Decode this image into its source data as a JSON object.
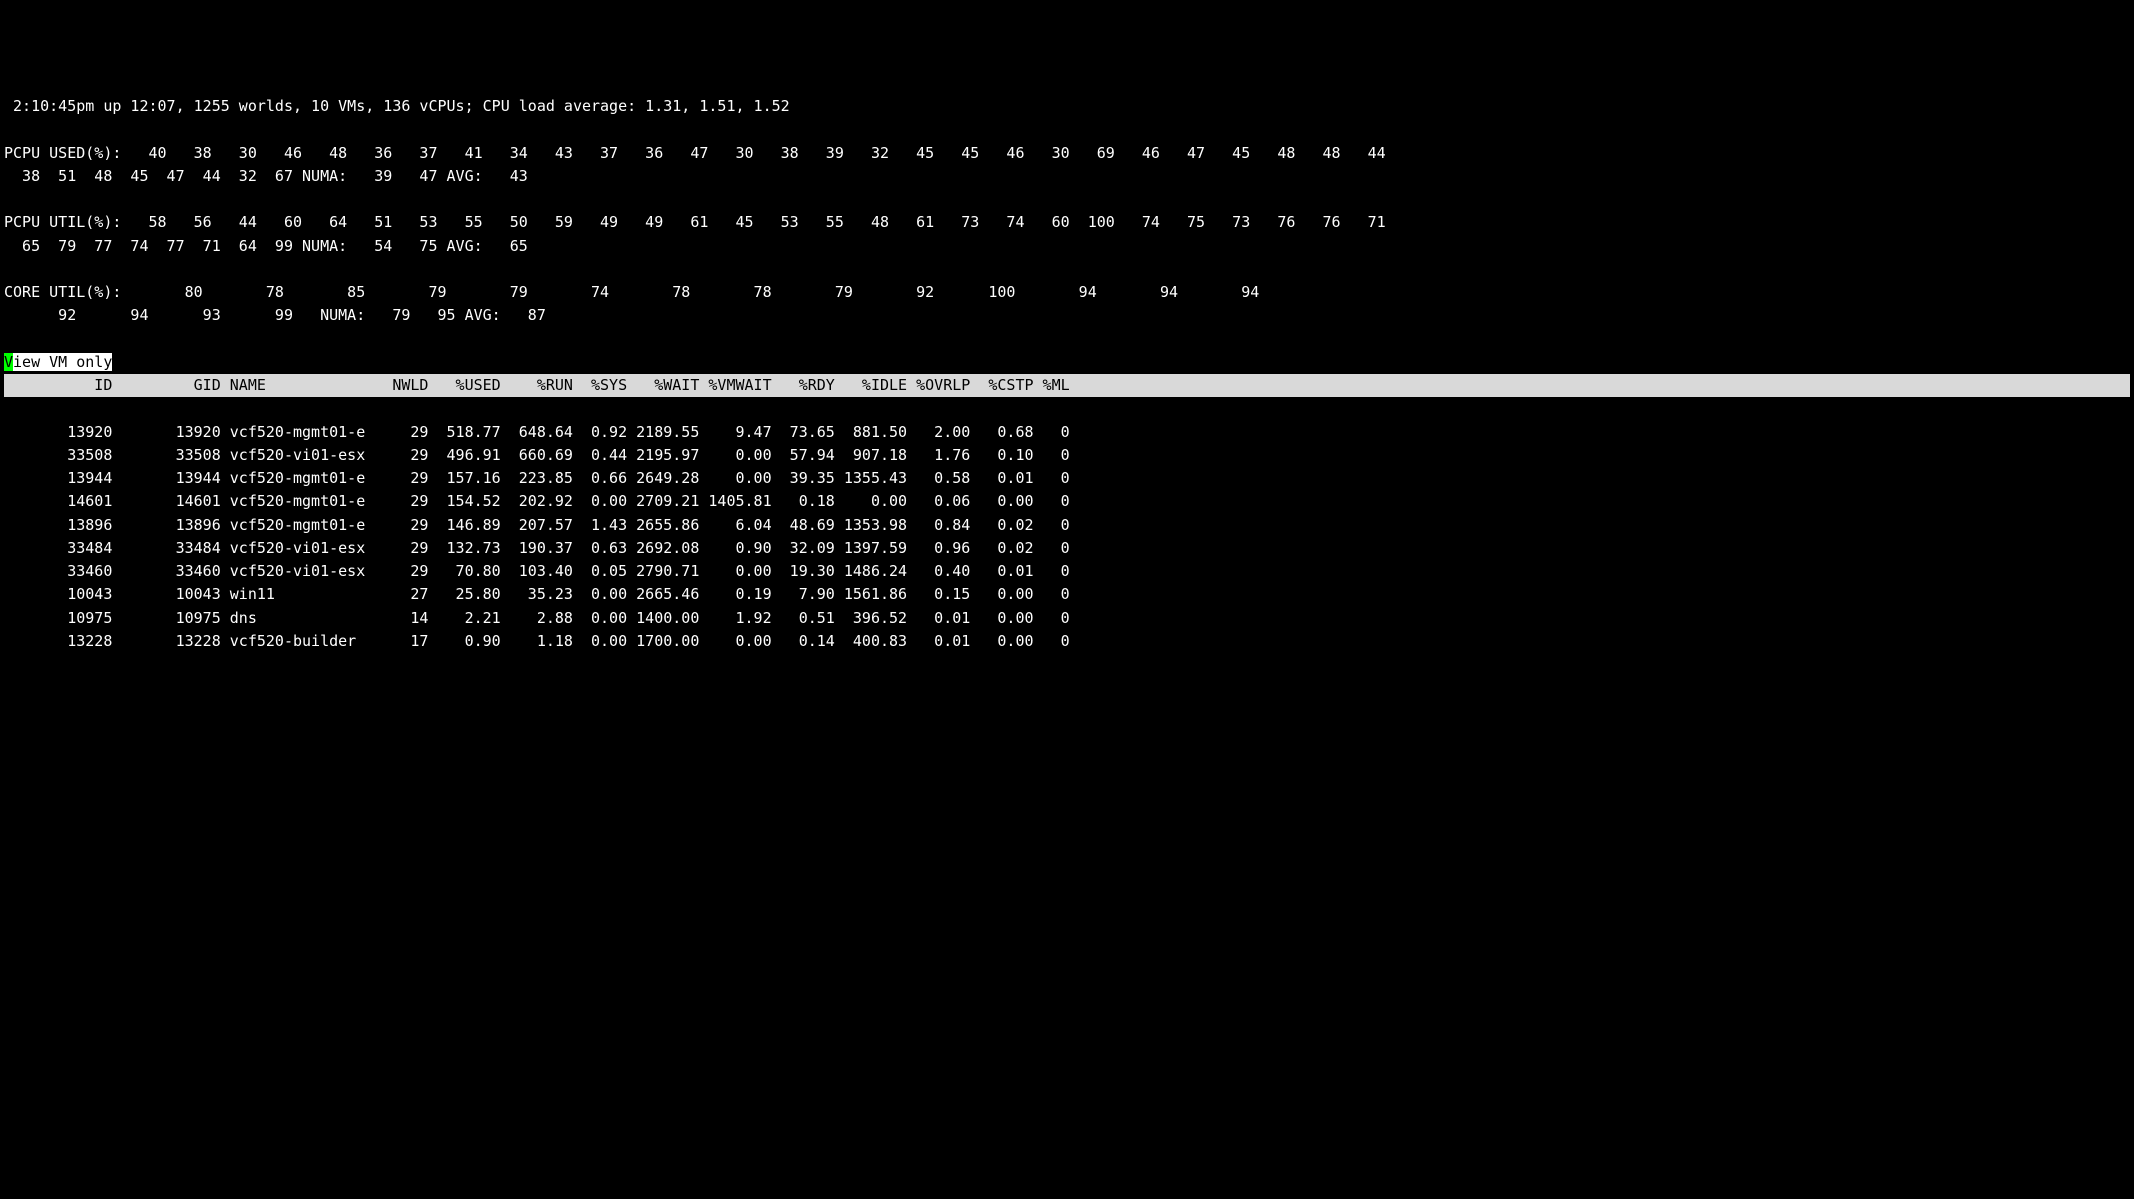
{
  "summary": {
    "line1": " 2:10:45pm up 12:07, 1255 worlds, 10 VMs, 136 vCPUs; CPU load average: 1.31, 1.51, 1.52",
    "pcpu_used_label": "PCPU USED(%):",
    "pcpu_used_vals": [
      "40",
      "38",
      "30",
      "46",
      "48",
      "36",
      "37",
      "41",
      "34",
      "43",
      "37",
      "36",
      "47",
      "30",
      "38",
      "39",
      "32",
      "45",
      "45",
      "46",
      "30",
      "69",
      "46",
      "47",
      "45",
      "48",
      "48",
      "44",
      "38",
      "51",
      "48",
      "45",
      "47",
      "44",
      "32",
      "67"
    ],
    "pcpu_used_numa_label": "NUMA:",
    "pcpu_used_numa_vals": [
      "39",
      "47"
    ],
    "pcpu_used_avg_label": "AVG:",
    "pcpu_used_avg_val": "43",
    "pcpu_util_label": "PCPU UTIL(%):",
    "pcpu_util_vals": [
      "58",
      "56",
      "44",
      "60",
      "64",
      "51",
      "53",
      "55",
      "50",
      "59",
      "49",
      "49",
      "61",
      "45",
      "53",
      "55",
      "48",
      "61",
      "73",
      "74",
      "60",
      "100",
      "74",
      "75",
      "73",
      "76",
      "76",
      "71",
      "65",
      "79",
      "77",
      "74",
      "77",
      "71",
      "64",
      "99"
    ],
    "pcpu_util_numa_label": "NUMA:",
    "pcpu_util_numa_vals": [
      "54",
      "75"
    ],
    "pcpu_util_avg_label": "AVG:",
    "pcpu_util_avg_val": "65",
    "core_util_label": "CORE UTIL(%):",
    "core_util_vals": [
      "80",
      "78",
      "85",
      "79",
      "79",
      "74",
      "78",
      "78",
      "79",
      "92",
      "100",
      "94",
      "94",
      "94",
      "92",
      "94",
      "93",
      "99"
    ],
    "core_util_numa_label": "NUMA:",
    "core_util_numa_vals": [
      "79",
      "95"
    ],
    "core_util_avg_label": "AVG:",
    "core_util_avg_val": "87"
  },
  "mode": {
    "first": "V",
    "rest": "iew VM only"
  },
  "columns": [
    "ID",
    "GID",
    "NAME",
    "NWLD",
    "%USED",
    "%RUN",
    "%SYS",
    "%WAIT",
    "%VMWAIT",
    "%RDY",
    "%IDLE",
    "%OVRLP",
    "%CSTP",
    "%ML"
  ],
  "widths": [
    12,
    12,
    16,
    6,
    8,
    8,
    6,
    8,
    8,
    7,
    8,
    7,
    7,
    4
  ],
  "name_width": 16,
  "rows": [
    {
      "id": "13920",
      "gid": "13920",
      "name": "vcf520-mgmt01-e",
      "nwld": "29",
      "used": "518.77",
      "run": "648.64",
      "sys": "0.92",
      "wait": "2189.55",
      "vmwait": "9.47",
      "rdy": "73.65",
      "idle": "881.50",
      "ovrlp": "2.00",
      "cstp": "0.68",
      "ml": "0"
    },
    {
      "id": "33508",
      "gid": "33508",
      "name": "vcf520-vi01-esx",
      "nwld": "29",
      "used": "496.91",
      "run": "660.69",
      "sys": "0.44",
      "wait": "2195.97",
      "vmwait": "0.00",
      "rdy": "57.94",
      "idle": "907.18",
      "ovrlp": "1.76",
      "cstp": "0.10",
      "ml": "0"
    },
    {
      "id": "13944",
      "gid": "13944",
      "name": "vcf520-mgmt01-e",
      "nwld": "29",
      "used": "157.16",
      "run": "223.85",
      "sys": "0.66",
      "wait": "2649.28",
      "vmwait": "0.00",
      "rdy": "39.35",
      "idle": "1355.43",
      "ovrlp": "0.58",
      "cstp": "0.01",
      "ml": "0"
    },
    {
      "id": "14601",
      "gid": "14601",
      "name": "vcf520-mgmt01-e",
      "nwld": "29",
      "used": "154.52",
      "run": "202.92",
      "sys": "0.00",
      "wait": "2709.21",
      "vmwait": "1405.81",
      "rdy": "0.18",
      "idle": "0.00",
      "ovrlp": "0.06",
      "cstp": "0.00",
      "ml": "0"
    },
    {
      "id": "13896",
      "gid": "13896",
      "name": "vcf520-mgmt01-e",
      "nwld": "29",
      "used": "146.89",
      "run": "207.57",
      "sys": "1.43",
      "wait": "2655.86",
      "vmwait": "6.04",
      "rdy": "48.69",
      "idle": "1353.98",
      "ovrlp": "0.84",
      "cstp": "0.02",
      "ml": "0"
    },
    {
      "id": "33484",
      "gid": "33484",
      "name": "vcf520-vi01-esx",
      "nwld": "29",
      "used": "132.73",
      "run": "190.37",
      "sys": "0.63",
      "wait": "2692.08",
      "vmwait": "0.90",
      "rdy": "32.09",
      "idle": "1397.59",
      "ovrlp": "0.96",
      "cstp": "0.02",
      "ml": "0"
    },
    {
      "id": "33460",
      "gid": "33460",
      "name": "vcf520-vi01-esx",
      "nwld": "29",
      "used": "70.80",
      "run": "103.40",
      "sys": "0.05",
      "wait": "2790.71",
      "vmwait": "0.00",
      "rdy": "19.30",
      "idle": "1486.24",
      "ovrlp": "0.40",
      "cstp": "0.01",
      "ml": "0"
    },
    {
      "id": "10043",
      "gid": "10043",
      "name": "win11",
      "nwld": "27",
      "used": "25.80",
      "run": "35.23",
      "sys": "0.00",
      "wait": "2665.46",
      "vmwait": "0.19",
      "rdy": "7.90",
      "idle": "1561.86",
      "ovrlp": "0.15",
      "cstp": "0.00",
      "ml": "0"
    },
    {
      "id": "10975",
      "gid": "10975",
      "name": "dns",
      "nwld": "14",
      "used": "2.21",
      "run": "2.88",
      "sys": "0.00",
      "wait": "1400.00",
      "vmwait": "1.92",
      "rdy": "0.51",
      "idle": "396.52",
      "ovrlp": "0.01",
      "cstp": "0.00",
      "ml": "0"
    },
    {
      "id": "13228",
      "gid": "13228",
      "name": "vcf520-builder",
      "nwld": "17",
      "used": "0.90",
      "run": "1.18",
      "sys": "0.00",
      "wait": "1700.00",
      "vmwait": "0.00",
      "rdy": "0.14",
      "idle": "400.83",
      "ovrlp": "0.01",
      "cstp": "0.00",
      "ml": "0"
    }
  ]
}
